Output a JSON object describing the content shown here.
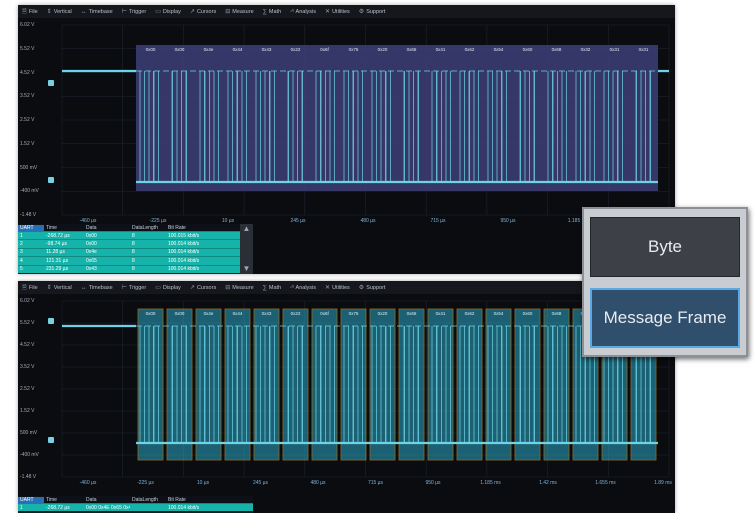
{
  "menu": [
    {
      "icon": "file-icon",
      "glyph": "🗎",
      "label": "File"
    },
    {
      "icon": "vertical-icon",
      "glyph": "⇕",
      "label": "Vertical"
    },
    {
      "icon": "timebase-icon",
      "glyph": "↔",
      "label": "Timebase"
    },
    {
      "icon": "trigger-icon",
      "glyph": "⊢",
      "label": "Trigger"
    },
    {
      "icon": "display-icon",
      "glyph": "▭",
      "label": "Display"
    },
    {
      "icon": "cursors-icon",
      "glyph": "↗",
      "label": "Cursors"
    },
    {
      "icon": "measure-icon",
      "glyph": "⊟",
      "label": "Measure"
    },
    {
      "icon": "math-icon",
      "glyph": "∑",
      "label": "Math"
    },
    {
      "icon": "analysis-icon",
      "glyph": "⩘",
      "label": "Analysis"
    },
    {
      "icon": "utilities-icon",
      "glyph": "✕",
      "label": "Utilities"
    },
    {
      "icon": "support-icon",
      "glyph": "⚙",
      "label": "Support"
    }
  ],
  "top": {
    "y_labels": [
      "6.02 V",
      "5.52 V",
      "4.52 V",
      "3.52 V",
      "2.52 V",
      "1.52 V",
      "500 mV",
      "-400 mV",
      "-1.48 V"
    ],
    "x_labels": [
      "-460 µs",
      "-225 µs",
      "10 µs",
      "245 µs",
      "480 µs",
      "715 µs",
      "950 µs",
      "1.185 ms",
      "1.42 ms"
    ],
    "frames": [
      "0x00",
      "0x00",
      "0x4e",
      "0x44",
      "0x43",
      "0x22",
      "0x6f",
      "0x75",
      "0x20",
      "0x66",
      "0x41",
      "0x62",
      "0x54",
      "0x60",
      "0x68",
      "0x32",
      "0x31",
      "0x31"
    ],
    "table": {
      "headers": [
        "UART",
        "Time",
        "Data",
        "DataLength",
        "Bit Rate"
      ],
      "rows": [
        [
          "1",
          "-268.72 µs",
          "0x00",
          "8",
          "100.015 kbit/s"
        ],
        [
          "2",
          "-98.74 µs",
          "0x00",
          "8",
          "100.014 kbit/s"
        ],
        [
          "3",
          "11.28 µs",
          "0x4e",
          "8",
          "100.014 kbit/s"
        ],
        [
          "4",
          "121.31 µs",
          "0x65",
          "8",
          "100.014 kbit/s"
        ],
        [
          "5",
          "231.29 µs",
          "0x43",
          "8",
          "100.014 kbit/s"
        ]
      ]
    }
  },
  "bottom": {
    "y_labels": [
      "6.02 V",
      "5.52 V",
      "4.52 V",
      "3.52 V",
      "2.52 V",
      "1.52 V",
      "500 mV",
      "-400 mV",
      "-1.48 V"
    ],
    "x_labels": [
      "-460 µs",
      "-225 µs",
      "10 µs",
      "245 µs",
      "480 µs",
      "715 µs",
      "950 µs",
      "1.185 ms",
      "1.42 ms",
      "1.655 ms",
      "1.89 ms"
    ],
    "frames": [
      "0x00",
      "0x00",
      "0x4e",
      "0x44",
      "0x43",
      "0x22",
      "0x6f",
      "0x75",
      "0x20",
      "0x66",
      "0x41",
      "0x62",
      "0x54",
      "0x60",
      "0x68",
      "0x32",
      "0x31",
      "0x31"
    ],
    "table": {
      "headers": [
        "UART",
        "Time",
        "Data",
        "DataLength",
        "Bit Rate"
      ],
      "rows": [
        [
          "1",
          "-268.72 µs",
          "0x00 0x4E 0x65 0x43 0x22 0x4E 0x75 0 ...",
          "",
          "100.014 kbit/s"
        ]
      ]
    }
  },
  "popup": {
    "byte_label": "Byte",
    "frame_label": "Message Frame"
  },
  "colors": {
    "trace": "#6fd3e6",
    "byte_fill": "#3c3f78",
    "frame_fill": "#2aa8c4",
    "frame_border": "#d6b24a",
    "table_row": "#15b3a9",
    "selected_border": "#5aa8e6"
  }
}
